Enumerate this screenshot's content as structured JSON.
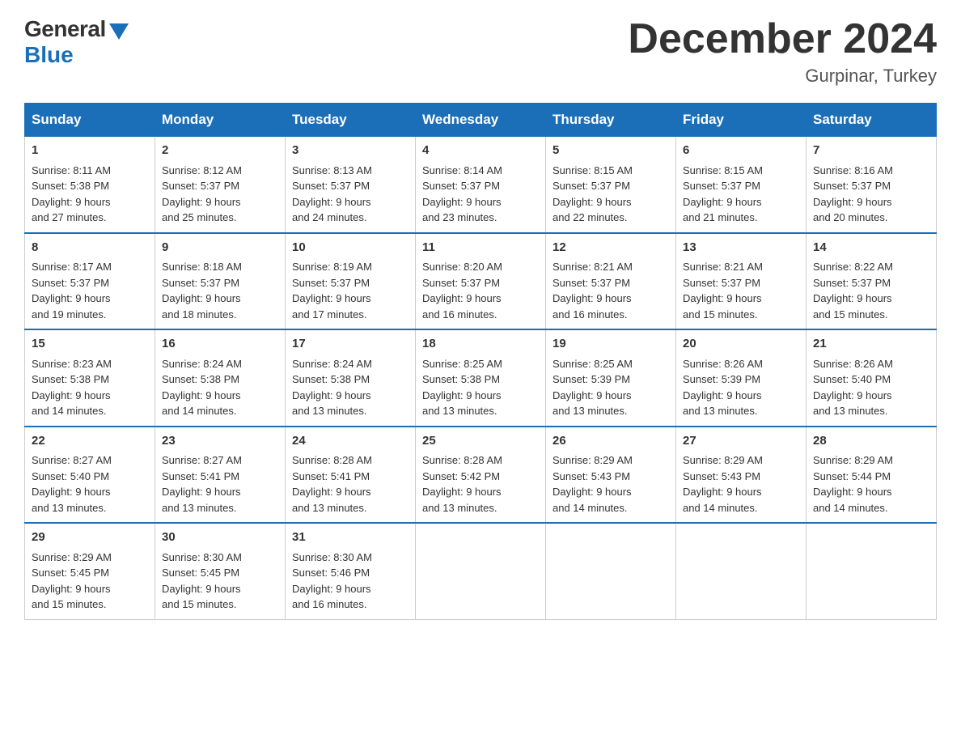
{
  "logo": {
    "general": "General",
    "blue": "Blue"
  },
  "title": "December 2024",
  "location": "Gurpinar, Turkey",
  "days_of_week": [
    "Sunday",
    "Monday",
    "Tuesday",
    "Wednesday",
    "Thursday",
    "Friday",
    "Saturday"
  ],
  "weeks": [
    [
      {
        "day": "1",
        "sunrise": "8:11 AM",
        "sunset": "5:38 PM",
        "daylight": "9 hours and 27 minutes."
      },
      {
        "day": "2",
        "sunrise": "8:12 AM",
        "sunset": "5:37 PM",
        "daylight": "9 hours and 25 minutes."
      },
      {
        "day": "3",
        "sunrise": "8:13 AM",
        "sunset": "5:37 PM",
        "daylight": "9 hours and 24 minutes."
      },
      {
        "day": "4",
        "sunrise": "8:14 AM",
        "sunset": "5:37 PM",
        "daylight": "9 hours and 23 minutes."
      },
      {
        "day": "5",
        "sunrise": "8:15 AM",
        "sunset": "5:37 PM",
        "daylight": "9 hours and 22 minutes."
      },
      {
        "day": "6",
        "sunrise": "8:15 AM",
        "sunset": "5:37 PM",
        "daylight": "9 hours and 21 minutes."
      },
      {
        "day": "7",
        "sunrise": "8:16 AM",
        "sunset": "5:37 PM",
        "daylight": "9 hours and 20 minutes."
      }
    ],
    [
      {
        "day": "8",
        "sunrise": "8:17 AM",
        "sunset": "5:37 PM",
        "daylight": "9 hours and 19 minutes."
      },
      {
        "day": "9",
        "sunrise": "8:18 AM",
        "sunset": "5:37 PM",
        "daylight": "9 hours and 18 minutes."
      },
      {
        "day": "10",
        "sunrise": "8:19 AM",
        "sunset": "5:37 PM",
        "daylight": "9 hours and 17 minutes."
      },
      {
        "day": "11",
        "sunrise": "8:20 AM",
        "sunset": "5:37 PM",
        "daylight": "9 hours and 16 minutes."
      },
      {
        "day": "12",
        "sunrise": "8:21 AM",
        "sunset": "5:37 PM",
        "daylight": "9 hours and 16 minutes."
      },
      {
        "day": "13",
        "sunrise": "8:21 AM",
        "sunset": "5:37 PM",
        "daylight": "9 hours and 15 minutes."
      },
      {
        "day": "14",
        "sunrise": "8:22 AM",
        "sunset": "5:37 PM",
        "daylight": "9 hours and 15 minutes."
      }
    ],
    [
      {
        "day": "15",
        "sunrise": "8:23 AM",
        "sunset": "5:38 PM",
        "daylight": "9 hours and 14 minutes."
      },
      {
        "day": "16",
        "sunrise": "8:24 AM",
        "sunset": "5:38 PM",
        "daylight": "9 hours and 14 minutes."
      },
      {
        "day": "17",
        "sunrise": "8:24 AM",
        "sunset": "5:38 PM",
        "daylight": "9 hours and 13 minutes."
      },
      {
        "day": "18",
        "sunrise": "8:25 AM",
        "sunset": "5:38 PM",
        "daylight": "9 hours and 13 minutes."
      },
      {
        "day": "19",
        "sunrise": "8:25 AM",
        "sunset": "5:39 PM",
        "daylight": "9 hours and 13 minutes."
      },
      {
        "day": "20",
        "sunrise": "8:26 AM",
        "sunset": "5:39 PM",
        "daylight": "9 hours and 13 minutes."
      },
      {
        "day": "21",
        "sunrise": "8:26 AM",
        "sunset": "5:40 PM",
        "daylight": "9 hours and 13 minutes."
      }
    ],
    [
      {
        "day": "22",
        "sunrise": "8:27 AM",
        "sunset": "5:40 PM",
        "daylight": "9 hours and 13 minutes."
      },
      {
        "day": "23",
        "sunrise": "8:27 AM",
        "sunset": "5:41 PM",
        "daylight": "9 hours and 13 minutes."
      },
      {
        "day": "24",
        "sunrise": "8:28 AM",
        "sunset": "5:41 PM",
        "daylight": "9 hours and 13 minutes."
      },
      {
        "day": "25",
        "sunrise": "8:28 AM",
        "sunset": "5:42 PM",
        "daylight": "9 hours and 13 minutes."
      },
      {
        "day": "26",
        "sunrise": "8:29 AM",
        "sunset": "5:43 PM",
        "daylight": "9 hours and 14 minutes."
      },
      {
        "day": "27",
        "sunrise": "8:29 AM",
        "sunset": "5:43 PM",
        "daylight": "9 hours and 14 minutes."
      },
      {
        "day": "28",
        "sunrise": "8:29 AM",
        "sunset": "5:44 PM",
        "daylight": "9 hours and 14 minutes."
      }
    ],
    [
      {
        "day": "29",
        "sunrise": "8:29 AM",
        "sunset": "5:45 PM",
        "daylight": "9 hours and 15 minutes."
      },
      {
        "day": "30",
        "sunrise": "8:30 AM",
        "sunset": "5:45 PM",
        "daylight": "9 hours and 15 minutes."
      },
      {
        "day": "31",
        "sunrise": "8:30 AM",
        "sunset": "5:46 PM",
        "daylight": "9 hours and 16 minutes."
      },
      null,
      null,
      null,
      null
    ]
  ],
  "labels": {
    "sunrise": "Sunrise:",
    "sunset": "Sunset:",
    "daylight": "Daylight:"
  }
}
